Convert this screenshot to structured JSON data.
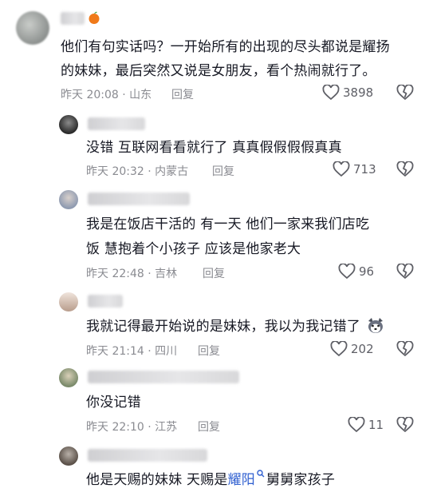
{
  "comments": [
    {
      "text_lines": [
        "他们有句实话吗？一开始所有的出现的尽头都说是耀扬",
        "的妹妹，最后突然又说是女朋友，看个热闹就行了。"
      ],
      "time": "昨天 20:08",
      "location": "山东",
      "reply": "回复",
      "likes": "3898"
    },
    {
      "text_lines": [
        "没错 互联网看看就行了 真真假假假假真真"
      ],
      "time": "昨天 20:32",
      "location": "内蒙古",
      "reply": "回复",
      "likes": "713"
    },
    {
      "text_lines": [
        "我是在饭店干活的  有一天  他们一家来我们店吃",
        "饭  慧抱着个小孩子   应该是他家老大"
      ],
      "time": "昨天 22:48",
      "location": "吉林",
      "reply": "回复",
      "likes": "96"
    },
    {
      "text_lines": [
        "我就记得最开始说的是妹妹，我以为我记错了"
      ],
      "time": "昨天 21:14",
      "location": "四川",
      "reply": "回复",
      "likes": "202"
    },
    {
      "text_lines": [
        "你没记错"
      ],
      "time": "昨天 22:10",
      "location": "江苏",
      "reply": "回复",
      "likes": "11"
    },
    {
      "text_prefix": "他是天赐的妹妹  天赐是",
      "keyword": "耀阳",
      "text_suffix": "舅舅家孩子"
    }
  ],
  "icons": [
    "heart-outline-icon",
    "dislike-heart-icon",
    "search-icon",
    "husky-emoji-icon",
    "orange-badge-icon"
  ],
  "colors": {
    "text": "#161823",
    "meta": "#8a8b91",
    "keyword": "#2f5fd0"
  }
}
